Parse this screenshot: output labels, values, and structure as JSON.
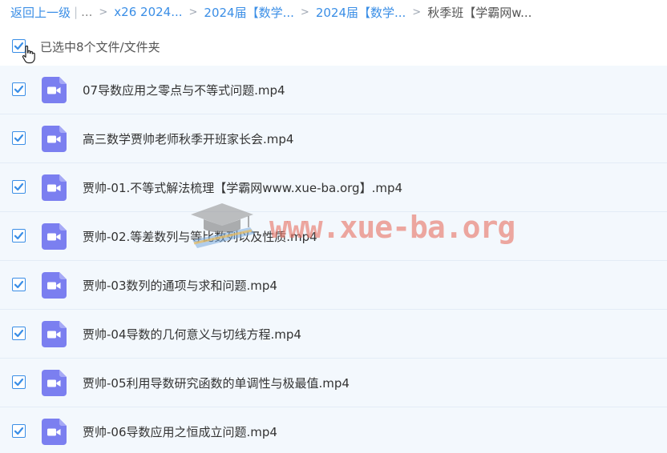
{
  "breadcrumb": {
    "back_label": "返回上一级",
    "ellipsis": "...",
    "items": [
      "x26 2024...",
      "2024届【数学...",
      "2024届【数学..."
    ],
    "current": "秋季班【学霸网w..."
  },
  "selection": {
    "text": "已选中8个文件/文件夹",
    "checked": true
  },
  "files": [
    {
      "name": "07导数应用之零点与不等式问题.mp4",
      "checked": true,
      "type": "video"
    },
    {
      "name": "高三数学贾帅老师秋季开班家长会.mp4",
      "checked": true,
      "type": "video"
    },
    {
      "name": "贾帅-01.不等式解法梳理【学霸网www.xue-ba.org】.mp4",
      "checked": true,
      "type": "video"
    },
    {
      "name": "贾帅-02.等差数列与等比数列以及性质.mp4",
      "checked": true,
      "type": "video"
    },
    {
      "name": "贾帅-03数列的通项与求和问题.mp4",
      "checked": true,
      "type": "video"
    },
    {
      "name": "贾帅-04导数的几何意义与切线方程.mp4",
      "checked": true,
      "type": "video"
    },
    {
      "name": "贾帅-05利用导数研究函数的单调性与极最值.mp4",
      "checked": true,
      "type": "video"
    },
    {
      "name": "贾帅-06导数应用之恒成立问题.mp4",
      "checked": true,
      "type": "video"
    }
  ],
  "watermark": {
    "text": "www.xue-ba.org"
  },
  "colors": {
    "accent": "#3a8ee6",
    "video_icon": "#7b7ff0",
    "row_bg": "#f3f8fd",
    "watermark": "#e87060"
  },
  "icons": {
    "checkbox": "check-icon",
    "file": "video-file-icon",
    "cursor": "hand-pointer-icon",
    "watermark_logo": "graduation-cap-icon"
  }
}
